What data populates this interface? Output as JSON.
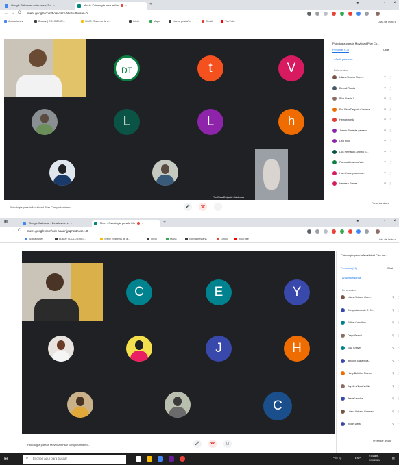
{
  "top": {
    "tabs": [
      {
        "label": "Google Calendar - miércoles, 7 o",
        "favicon_color": "#4285f4",
        "active": false
      },
      {
        "label": "Meet - Psicología para la Mo",
        "favicon_color": "#00897b",
        "active": true
      }
    ],
    "url": "meet.google.com/how-qazz-hhi?authuser=0",
    "bookmarks": [
      "Aplicaciones",
      "Buscar | COLCIENCI...",
      "SIMO -Sistema de a...",
      "Inicio",
      "Mapa",
      "Nueva pestaña",
      "Gmail",
      "YouTube"
    ],
    "reading_list": "Lista de lectura",
    "meeting_name": "Psicología para la Movilidad Pilar Comportamiento...",
    "tiles": [
      {
        "type": "camera",
        "name": ""
      },
      {
        "type": "logo",
        "letter": "DT",
        "color": "#0b8043"
      },
      {
        "type": "letter",
        "letter": "t",
        "color": "#f4511e"
      },
      {
        "type": "letter",
        "letter": "V",
        "color": "#d81b60"
      },
      {
        "type": "photo",
        "letter": ""
      },
      {
        "type": "letter",
        "letter": "L",
        "color": "#0b5345"
      },
      {
        "type": "letter",
        "letter": "L",
        "color": "#8e24aa"
      },
      {
        "type": "letter",
        "letter": "h",
        "color": "#ef6c00"
      },
      {
        "type": "photo",
        "letter": ""
      },
      {
        "type": "photo",
        "letter": ""
      },
      {
        "type": "camera2",
        "name": "Flor Elvia Delgado Cárdenas"
      }
    ],
    "panel": {
      "title": "Psicología para la Movilidad Pilar Co...",
      "tab_people": "Personas (13)",
      "tab_chat": "Chat",
      "add_people": "Añadir personas",
      "section": "En la reunión",
      "people": [
        {
          "name": "Liliana Urbano Guerr...",
          "color": "#795548",
          "initial": ""
        },
        {
          "name": "Derneli Rueda",
          "color": "#455a64",
          "initial": ""
        },
        {
          "name": "Pilar Rueda V.",
          "color": "#8d6e63",
          "initial": ""
        },
        {
          "name": "Flor Elvia Delgado Cárdena...",
          "color": "#ef6c00",
          "initial": ""
        },
        {
          "name": "Hernan rueda",
          "color": "#e53935",
          "initial": ""
        },
        {
          "name": "Jasmin Pimienta galeano",
          "color": "#8e24aa",
          "initial": ""
        },
        {
          "name": "Lina Rico",
          "color": "#8e24aa",
          "initial": ""
        },
        {
          "name": "Luis Hernando Ospina G...",
          "color": "#0b5345",
          "initial": ""
        },
        {
          "name": "Pamela Alejandra Vás",
          "color": "#0b8043",
          "initial": ""
        },
        {
          "name": "Haerith con poucoma...",
          "color": "#d81b60",
          "initial": ""
        },
        {
          "name": "Vanessa Gómez",
          "color": "#d81b60",
          "initial": ""
        }
      ]
    },
    "present_label": "Presentar ahora"
  },
  "bottom": {
    "tabs": [
      {
        "label": "Google Calendar - Detalles del e",
        "favicon_color": "#4285f4",
        "active": false
      },
      {
        "label": "Meet - Psicología para la Mo",
        "favicon_color": "#00897b",
        "active": true
      }
    ],
    "url": "meet.google.com/xok-aoaer-jpq?authuser=0",
    "bookmarks": [
      "Aplicaciones",
      "Buscar | COLCIENCI...",
      "SIMO -Sistema de a...",
      "Inicio",
      "Mapa",
      "Nueva pestaña",
      "Gmail",
      "YouTube"
    ],
    "reading_list": "Lista de lectura",
    "meeting_name": "Psicología para la Movilidad Pilar comportamiento...",
    "tiles": [
      {
        "type": "camera",
        "name": ""
      },
      {
        "type": "letter",
        "letter": "C",
        "color": "#00838f"
      },
      {
        "type": "letter",
        "letter": "E",
        "color": "#00838f"
      },
      {
        "type": "letter",
        "letter": "Y",
        "color": "#3949ab"
      },
      {
        "type": "photo",
        "letter": ""
      },
      {
        "type": "photo",
        "letter": ""
      },
      {
        "type": "letter",
        "letter": "J",
        "color": "#3949ab"
      },
      {
        "type": "letter",
        "letter": "H",
        "color": "#ef6c00"
      },
      {
        "type": "photo",
        "letter": ""
      },
      {
        "type": "photo",
        "letter": ""
      },
      {
        "type": "letter",
        "letter": "C",
        "color": "#1a4f8b"
      }
    ],
    "panel": {
      "title": "Psicología para la Movilidad Pilar co...",
      "tab_people": "Personas (14)",
      "tab_chat": "Chat",
      "add_people": "Añadir personas",
      "section": "En la reunión",
      "people": [
        {
          "name": "Liliana Urbano Guerr...",
          "color": "#795548",
          "initial": ""
        },
        {
          "name": "Comportamiento C. S.l...",
          "color": "#3949ab",
          "initial": ""
        },
        {
          "name": "Esther Caballero",
          "color": "#00838f",
          "initial": ""
        },
        {
          "name": "Diego Bernal",
          "color": "#8d6e63",
          "initial": ""
        },
        {
          "name": "Elsa Chaves",
          "color": "#00838f",
          "initial": ""
        },
        {
          "name": "geraldin castañeda...",
          "color": "#3949ab",
          "initial": ""
        },
        {
          "name": "Harry Bolaños Pinzon",
          "color": "#ef6c00",
          "initial": ""
        },
        {
          "name": "Joyelth Villota Velilla",
          "color": "#8d6e63",
          "initial": ""
        },
        {
          "name": "Jesus Vendaz",
          "color": "#3949ab",
          "initial": ""
        },
        {
          "name": "Liliana Urbano Guerrero",
          "color": "#795548",
          "initial": ""
        },
        {
          "name": "Yoldin Liera",
          "color": "#3949ab",
          "initial": ""
        }
      ]
    },
    "present_label": "Presentar ahora"
  },
  "taskbar": {
    "search_placeholder": "Escribe aquí para buscar",
    "tray_lang": "ESP",
    "tray_time": "9:04 a.m.",
    "tray_date": "7/10/2021"
  }
}
